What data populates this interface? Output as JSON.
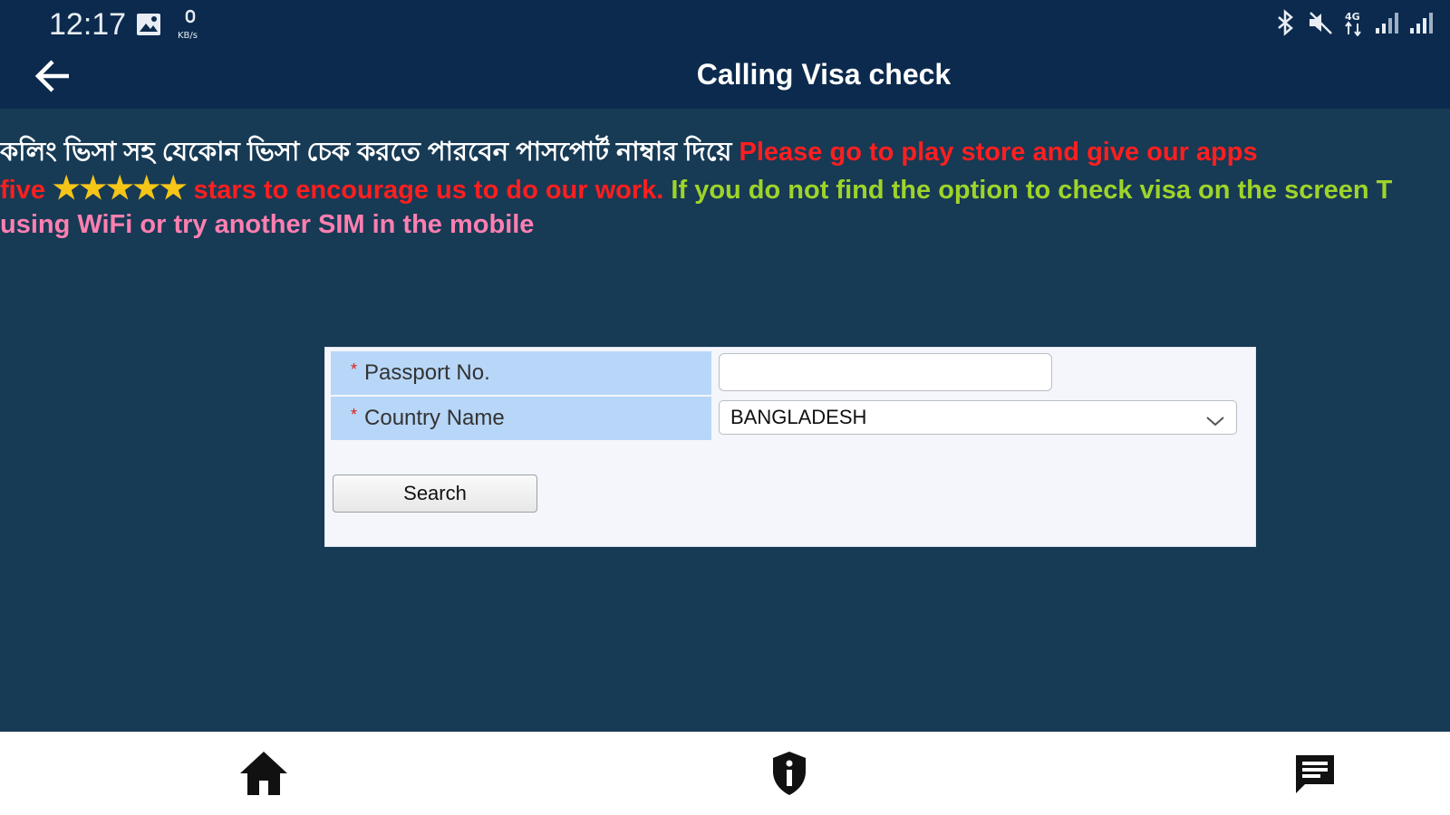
{
  "status_bar": {
    "time": "12:17",
    "icons_left": [
      "image-icon",
      "data-speed-icon"
    ],
    "icons_right": [
      "bluetooth-icon",
      "mute-icon",
      "4g-icon",
      "signal-icon",
      "signal-icon"
    ]
  },
  "app_bar": {
    "title": "Calling Visa check",
    "back_icon": "arrow-left-icon"
  },
  "notice": {
    "bengali": "কলিং ভিসা সহ যেকোন ভিসা চেক করতে পারবেন পাসপোর্ট নাম্বার দিয়ে ",
    "red_1": "Please go to play store and give our apps",
    "red_2": "five ",
    "stars": "★★★★★",
    "red_3": " stars to encourage us to do our work. ",
    "green": "If you do not find the option to check visa on the screen T",
    "pink": "using WiFi or try another SIM in the mobile"
  },
  "form": {
    "passport_label": "Passport No.",
    "passport_value": "",
    "country_label": "Country Name",
    "country_value": "BANGLADESH",
    "required_mark": "*",
    "search_label": "Search"
  },
  "bottom_nav": {
    "items": [
      {
        "icon": "home-icon"
      },
      {
        "icon": "info-shield-icon"
      },
      {
        "icon": "chat-icon"
      }
    ]
  },
  "colors": {
    "top_bar": "#0b2a4d",
    "background": "#173a55",
    "label_cell": "#b8d6f7",
    "notice_red": "#ff1f1f",
    "notice_green": "#9ed42a",
    "notice_pink": "#ff7fb0",
    "stars": "#f5c518"
  }
}
